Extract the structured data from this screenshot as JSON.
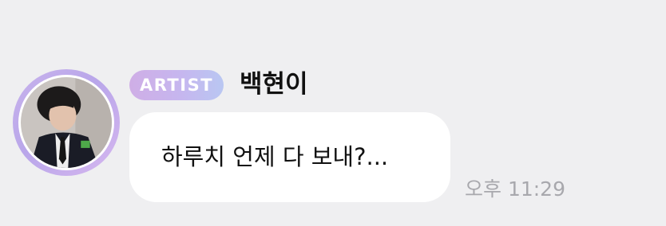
{
  "message": {
    "sender": {
      "badge_label": "ARTIST",
      "name": "백현이",
      "avatar_icon": "profile-photo"
    },
    "text": "하루치 언제 다 보내?...",
    "time": "오후 11:29"
  },
  "colors": {
    "background": "#efeff1",
    "bubble": "#ffffff",
    "badge_gradient_start": "#cfaee6",
    "badge_gradient_end": "#b9c7f2",
    "avatar_ring": "#c8b3ec",
    "timestamp": "#a8a8ad"
  }
}
